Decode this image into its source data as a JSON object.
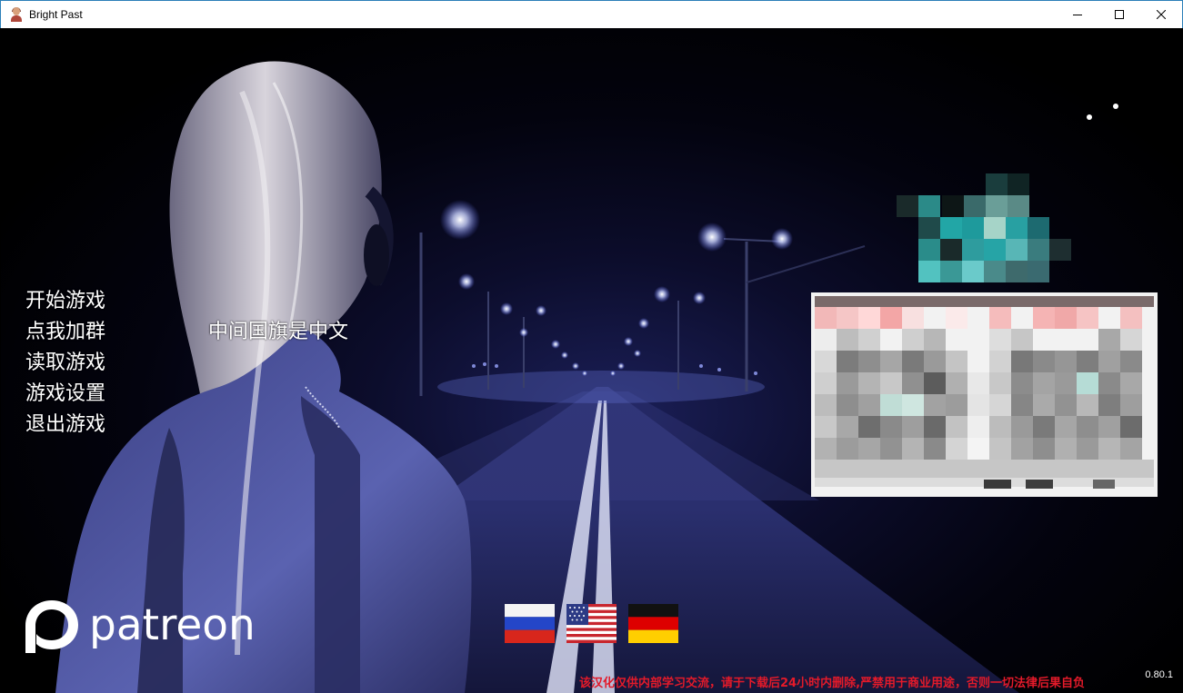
{
  "window": {
    "title": "Bright Past",
    "controls": [
      "minimize-icon",
      "maximize-icon",
      "close-icon"
    ]
  },
  "menu": {
    "items": [
      {
        "label": "开始游戏"
      },
      {
        "label": "点我加群"
      },
      {
        "label": "读取游戏"
      },
      {
        "label": "游戏设置"
      },
      {
        "label": "退出游戏"
      }
    ]
  },
  "flag_hint": "中间国旗是中文",
  "patreon": {
    "text": "patreon",
    "icon": "patreon-logo-icon"
  },
  "flags": [
    {
      "name": "russia-flag-icon"
    },
    {
      "name": "usa-flag-icon"
    },
    {
      "name": "germany-flag-icon"
    }
  ],
  "version": "0.80.1",
  "disclaimer": "该汉化仅供内部学习交流，请于下载后24小时内删除,严禁用于商业用途，否则一切法律后果自负",
  "colors": {
    "disclaimer": "#e31a2a",
    "menu_text": "#ffffff",
    "background": "#000000",
    "night_blue": "#1b1f58"
  }
}
